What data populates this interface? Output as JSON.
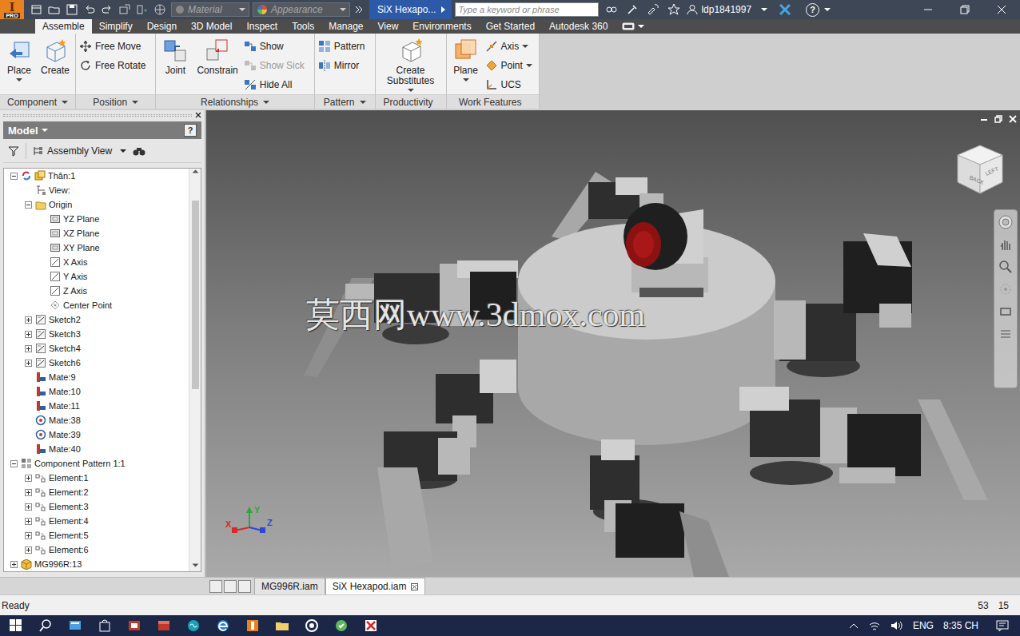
{
  "app": {
    "logo": {
      "letter": "I",
      "edition": "PRO"
    },
    "material": "Material",
    "appearance": "Appearance",
    "title": "SiX  Hexapo...",
    "search": {
      "placeholder": "Type a keyword or phrase"
    },
    "user": "ldp1841997",
    "help": "?"
  },
  "tabs": [
    {
      "label": "Assemble",
      "selected": true
    },
    {
      "label": "Simplify",
      "selected": false
    },
    {
      "label": "Design",
      "selected": false
    },
    {
      "label": "3D Model",
      "selected": false
    },
    {
      "label": "Inspect",
      "selected": false
    },
    {
      "label": "Tools",
      "selected": false
    },
    {
      "label": "Manage",
      "selected": false
    },
    {
      "label": "View",
      "selected": false
    },
    {
      "label": "Environments",
      "selected": false
    },
    {
      "label": "Get Started",
      "selected": false
    },
    {
      "label": "Autodesk 360",
      "selected": false
    }
  ],
  "ribbon": {
    "groups": [
      {
        "label": "Component",
        "menu": true,
        "tools": [
          {
            "label": "Place",
            "kind": "large",
            "dropdown": true,
            "disabled": false
          },
          {
            "label": "Create",
            "kind": "large",
            "dropdown": false,
            "disabled": false
          }
        ]
      },
      {
        "label": "Position",
        "menu": true,
        "tools": [
          {
            "label": "Free Move",
            "kind": "small",
            "dropdown": false,
            "disabled": false
          },
          {
            "label": "Free Rotate",
            "kind": "small",
            "dropdown": false,
            "disabled": false
          }
        ]
      },
      {
        "label": "Relationships",
        "menu": true,
        "tools": [
          {
            "label": "Joint",
            "kind": "large",
            "dropdown": false,
            "disabled": false
          },
          {
            "label": "Constrain",
            "kind": "large",
            "dropdown": false,
            "disabled": false
          },
          {
            "label": "Show",
            "kind": "small",
            "dropdown": false,
            "disabled": false
          },
          {
            "label": "Show Sick",
            "kind": "small",
            "dropdown": false,
            "disabled": true
          },
          {
            "label": "Hide All",
            "kind": "small",
            "dropdown": false,
            "disabled": false
          }
        ]
      },
      {
        "label": "Pattern",
        "menu": true,
        "tools": [
          {
            "label": "Pattern",
            "kind": "small",
            "dropdown": false,
            "disabled": false
          },
          {
            "label": "Mirror",
            "kind": "small",
            "dropdown": false,
            "disabled": false
          }
        ]
      },
      {
        "label": "Productivity",
        "menu": false,
        "tools": [
          {
            "label": "Create Substitutes",
            "kind": "large",
            "dropdown": true,
            "disabled": false
          }
        ]
      },
      {
        "label": "Work Features",
        "menu": false,
        "tools": [
          {
            "label": "Plane",
            "kind": "large",
            "dropdown": true,
            "disabled": false
          },
          {
            "label": "Axis",
            "kind": "small",
            "dropdown": true,
            "disabled": false
          },
          {
            "label": "Point",
            "kind": "small",
            "dropdown": true,
            "disabled": false
          },
          {
            "label": "UCS",
            "kind": "small",
            "dropdown": false,
            "disabled": false
          }
        ]
      }
    ]
  },
  "browser": {
    "title": "Model",
    "help": "?",
    "view": "Assembly View",
    "tree": [
      {
        "label": "Thân:1",
        "depth": 0,
        "kind": "root",
        "expandable": true,
        "expanded": true
      },
      {
        "label": "View:",
        "depth": 1,
        "kind": "view",
        "expandable": false,
        "expanded": false
      },
      {
        "label": "Origin",
        "depth": 1,
        "kind": "folder",
        "expandable": true,
        "expanded": true
      },
      {
        "label": "YZ Plane",
        "depth": 2,
        "kind": "plane",
        "expandable": false,
        "expanded": false
      },
      {
        "label": "XZ Plane",
        "depth": 2,
        "kind": "plane",
        "expandable": false,
        "expanded": false
      },
      {
        "label": "XY Plane",
        "depth": 2,
        "kind": "plane",
        "expandable": false,
        "expanded": false
      },
      {
        "label": "X Axis",
        "depth": 2,
        "kind": "axis",
        "expandable": false,
        "expanded": false
      },
      {
        "label": "Y Axis",
        "depth": 2,
        "kind": "axis",
        "expandable": false,
        "expanded": false
      },
      {
        "label": "Z Axis",
        "depth": 2,
        "kind": "axis",
        "expandable": false,
        "expanded": false
      },
      {
        "label": "Center Point",
        "depth": 2,
        "kind": "point",
        "expandable": false,
        "expanded": false
      },
      {
        "label": "Sketch2",
        "depth": 1,
        "kind": "sketch",
        "expandable": true,
        "expanded": false
      },
      {
        "label": "Sketch3",
        "depth": 1,
        "kind": "sketch",
        "expandable": true,
        "expanded": false
      },
      {
        "label": "Sketch4",
        "depth": 1,
        "kind": "sketch",
        "expandable": true,
        "expanded": false
      },
      {
        "label": "Sketch6",
        "depth": 1,
        "kind": "sketch",
        "expandable": true,
        "expanded": false
      },
      {
        "label": "Mate:9",
        "depth": 1,
        "kind": "mate",
        "expandable": false,
        "expanded": false
      },
      {
        "label": "Mate:10",
        "depth": 1,
        "kind": "mate",
        "expandable": false,
        "expanded": false
      },
      {
        "label": "Mate:11",
        "depth": 1,
        "kind": "mate",
        "expandable": false,
        "expanded": false
      },
      {
        "label": "Mate:38",
        "depth": 1,
        "kind": "insert",
        "expandable": false,
        "expanded": false
      },
      {
        "label": "Mate:39",
        "depth": 1,
        "kind": "insert",
        "expandable": false,
        "expanded": false
      },
      {
        "label": "Mate:40",
        "depth": 1,
        "kind": "mate",
        "expandable": false,
        "expanded": false
      },
      {
        "label": "Component Pattern 1:1",
        "depth": 0,
        "kind": "pattern",
        "expandable": true,
        "expanded": true
      },
      {
        "label": "Element:1",
        "depth": 1,
        "kind": "element",
        "expandable": true,
        "expanded": false
      },
      {
        "label": "Element:2",
        "depth": 1,
        "kind": "element",
        "expandable": true,
        "expanded": false
      },
      {
        "label": "Element:3",
        "depth": 1,
        "kind": "element",
        "expandable": true,
        "expanded": false
      },
      {
        "label": "Element:4",
        "depth": 1,
        "kind": "element",
        "expandable": true,
        "expanded": false
      },
      {
        "label": "Element:5",
        "depth": 1,
        "kind": "element",
        "expandable": true,
        "expanded": false
      },
      {
        "label": "Element:6",
        "depth": 1,
        "kind": "element",
        "expandable": true,
        "expanded": false
      },
      {
        "label": "MG996R:13",
        "depth": 0,
        "kind": "part",
        "expandable": true,
        "expanded": false
      }
    ]
  },
  "viewport": {
    "watermark": "莫西网www.3dmox.com",
    "viewcube": [
      "BACK",
      "LEFT"
    ],
    "axes": [
      {
        "label": "X",
        "color": "#d42a2a"
      },
      {
        "label": "Y",
        "color": "#2aa838"
      },
      {
        "label": "Z",
        "color": "#2a48d4"
      }
    ]
  },
  "documents": [
    {
      "label": "MG996R.iam",
      "selected": false
    },
    {
      "label": "SiX Hexapod.iam",
      "selected": true
    }
  ],
  "status_bar": {
    "message": "Ready",
    "values": [
      "53",
      "15"
    ]
  },
  "taskbar": {
    "language": "ENG",
    "clock": "8:35 CH"
  }
}
